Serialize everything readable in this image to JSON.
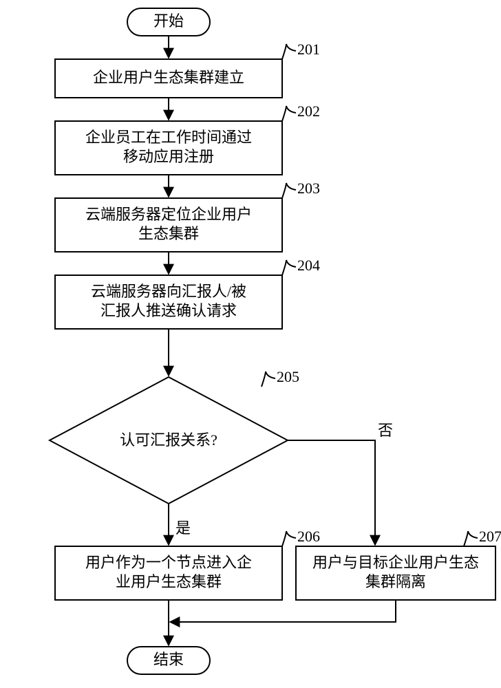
{
  "start": "开始",
  "end": "结束",
  "steps": {
    "s201": {
      "num": "201",
      "text": [
        "企业用户生态集群建立"
      ]
    },
    "s202": {
      "num": "202",
      "text": [
        "企业员工在工作时间通过",
        "移动应用注册"
      ]
    },
    "s203": {
      "num": "203",
      "text": [
        "云端服务器定位企业用户",
        "生态集群"
      ]
    },
    "s204": {
      "num": "204",
      "text": [
        "云端服务器向汇报人/被",
        "汇报人推送确认请求"
      ]
    },
    "s205": {
      "num": "205",
      "text": [
        "认可汇报关系?"
      ]
    },
    "s206": {
      "num": "206",
      "text": [
        "用户作为一个节点进入企",
        "业用户生态集群"
      ]
    },
    "s207": {
      "num": "207",
      "text": [
        "用户与目标企业用户生态",
        "集群隔离"
      ]
    }
  },
  "branch_yes": "是",
  "branch_no": "否"
}
